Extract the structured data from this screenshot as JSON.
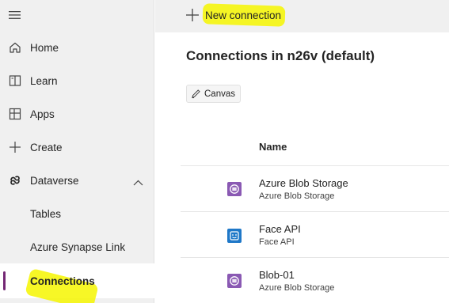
{
  "sidebar": {
    "menu_icon": "hamburger-icon",
    "items": [
      {
        "label": "Home",
        "icon": "home-icon"
      },
      {
        "label": "Learn",
        "icon": "book-icon"
      },
      {
        "label": "Apps",
        "icon": "apps-icon"
      },
      {
        "label": "Create",
        "icon": "plus-icon"
      },
      {
        "label": "Dataverse",
        "icon": "dataverse-icon",
        "expanded": true
      }
    ],
    "sub_items": [
      {
        "label": "Tables"
      },
      {
        "label": "Azure Synapse Link"
      },
      {
        "label": "Connections",
        "active": true
      }
    ]
  },
  "toolbar": {
    "new_connection_label": "New connection",
    "new_connection_icon": "plus-icon"
  },
  "main": {
    "title": "Connections in n26v (default)",
    "filter_chip": {
      "label": "Canvas",
      "icon": "pencil-icon"
    },
    "table": {
      "column_header": "Name",
      "rows": [
        {
          "name": "Azure Blob Storage",
          "connector": "Azure Blob Storage",
          "icon": "blob-storage-icon"
        },
        {
          "name": "Face API",
          "connector": "Face API",
          "icon": "face-api-icon"
        },
        {
          "name": "Blob-01",
          "connector": "Azure Blob Storage",
          "icon": "blob-storage-icon"
        }
      ]
    }
  },
  "colors": {
    "sidebar_bg": "#f0f0f0",
    "accent": "#742774",
    "highlight": "#f6f600",
    "blob_icon": "#8a59b3",
    "face_icon": "#1f78c8"
  }
}
